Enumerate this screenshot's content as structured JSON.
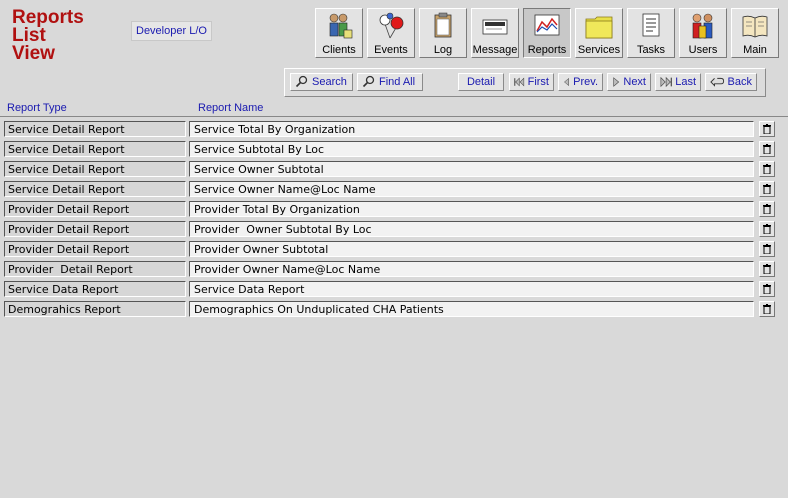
{
  "page": {
    "title_lines": [
      "Reports",
      "List",
      "View"
    ],
    "developer_label": "Developer L/O"
  },
  "toolbar": [
    {
      "label": "Clients",
      "icon": "clients-icon"
    },
    {
      "label": "Events",
      "icon": "events-icon"
    },
    {
      "label": "Log",
      "icon": "log-icon"
    },
    {
      "label": "Message",
      "icon": "message-icon"
    },
    {
      "label": "Reports",
      "icon": "reports-icon",
      "active": true
    },
    {
      "label": "Services",
      "icon": "folder-icon"
    },
    {
      "label": "Tasks",
      "icon": "tasks-icon"
    },
    {
      "label": "Users",
      "icon": "users-icon"
    },
    {
      "label": "Main",
      "icon": "book-icon"
    }
  ],
  "nav": {
    "search": "Search",
    "find_all": "Find All",
    "detail": "Detail",
    "first": "First",
    "prev": "Prev.",
    "next": "Next",
    "last": "Last",
    "back": "Back"
  },
  "columns": {
    "type": "Report Type",
    "name": "Report Name"
  },
  "rows": [
    {
      "type": "Service Detail Report",
      "name": "Service Total By Organization"
    },
    {
      "type": "Service Detail Report",
      "name": "Service Subtotal By Loc"
    },
    {
      "type": "Service Detail Report",
      "name": "Service Owner Subtotal"
    },
    {
      "type": "Service Detail Report",
      "name": "Service Owner Name@Loc Name"
    },
    {
      "type": "Provider Detail Report",
      "name": "Provider Total By Organization"
    },
    {
      "type": "Provider Detail Report",
      "name": "Provider  Owner Subtotal By Loc"
    },
    {
      "type": "Provider Detail Report",
      "name": "Provider Owner Subtotal"
    },
    {
      "type": "Provider  Detail Report",
      "name": "Provider Owner Name@Loc Name"
    },
    {
      "type": "Service Data Report",
      "name": "Service Data Report"
    },
    {
      "type": "Demograhics Report",
      "name": "Demographics On Unduplicated CHA Patients"
    }
  ]
}
